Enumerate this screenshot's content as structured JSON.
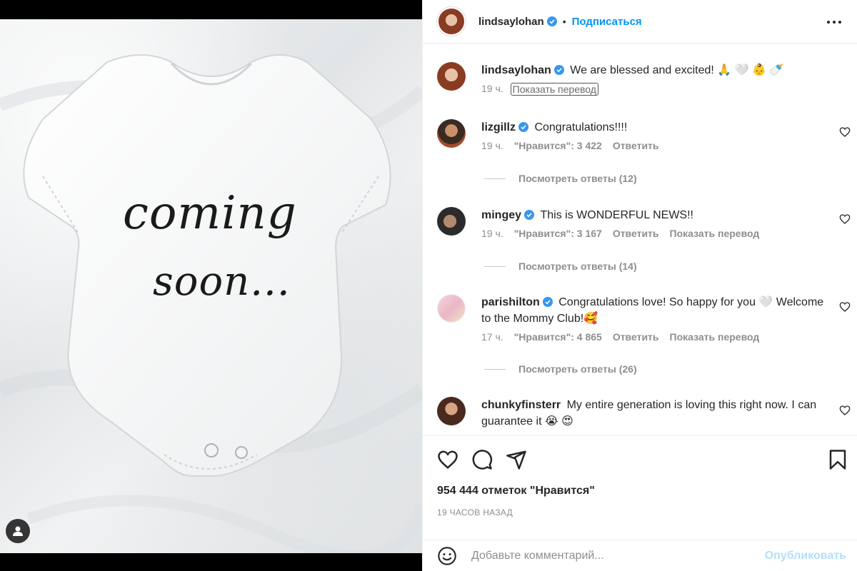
{
  "post": {
    "image_text": [
      "coming",
      "soon..."
    ],
    "author": "lindsaylohan",
    "follow_label": "Подписаться",
    "separator": "•"
  },
  "caption": {
    "username": "lindsaylohan",
    "text": "We are blessed and excited! 🙏 🤍 👶 🍼",
    "time": "19 ч.",
    "translate_label": "Показать перевод"
  },
  "comments": [
    {
      "username": "lizgillz",
      "text": "Congratulations!!!!",
      "time": "19 ч.",
      "likes": "\"Нравится\": 3 422",
      "reply": "Ответить",
      "translate": "",
      "view_replies": "Посмотреть ответы (12)"
    },
    {
      "username": "mingey",
      "text": "This is WONDERFUL NEWS!!",
      "time": "19 ч.",
      "likes": "\"Нравится\": 3 167",
      "reply": "Ответить",
      "translate": "Показать перевод",
      "view_replies": "Посмотреть ответы (14)"
    },
    {
      "username": "parishilton",
      "text": "Congratulations love! So happy for you 🤍 Welcome to the Mommy Club!🥰",
      "time": "17 ч.",
      "likes": "\"Нравится\": 4 865",
      "reply": "Ответить",
      "translate": "Показать перевод",
      "view_replies": "Посмотреть ответы (26)"
    },
    {
      "username": "chunkyfinsterr",
      "text": "My entire generation is loving this right now. I can guarantee it 😭 😍",
      "time": "",
      "likes": "",
      "reply": "",
      "translate": "",
      "view_replies": ""
    }
  ],
  "footer": {
    "likes": "954 444 отметок \"Нравится\"",
    "time_ago": "19 ЧАСОВ НАЗАД",
    "comment_placeholder": "Добавьте комментарий...",
    "publish_label": "Опубликовать"
  },
  "colors": {
    "accent": "#0095f6",
    "verified": "#3897f0",
    "publish_disabled": "#b2dffc",
    "muted": "#8e8e8e"
  },
  "icons": [
    "user-tag-icon",
    "more-icon",
    "verified-icon",
    "heart-icon",
    "comment-icon",
    "share-icon",
    "bookmark-icon",
    "emoji-icon"
  ]
}
